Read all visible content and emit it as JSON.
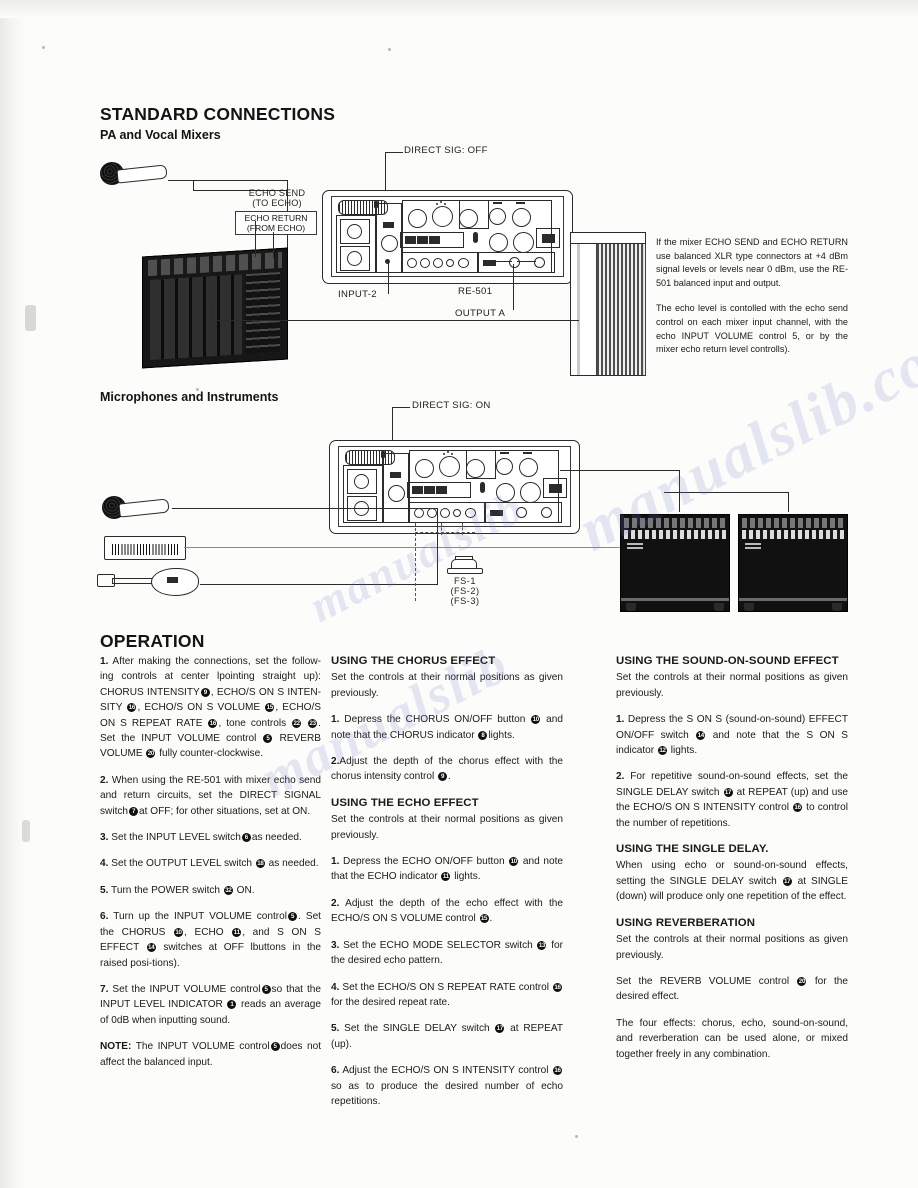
{
  "page": {
    "section_title": "STANDARD CONNECTIONS",
    "subsection_1": "PA and Vocal Mixers",
    "subsection_2": "Microphones and Instruments",
    "operation_title": "OPERATION"
  },
  "diagram1": {
    "name": "pa-and-vocal-mixers-diagram",
    "labels": {
      "direct_sig": "DIRECT SIG: OFF",
      "echo_send": "ECHO SEND",
      "echo_send_sub": "(TO ECHO)",
      "echo_return": "ECHO RETURN",
      "echo_return_sub": "(FROM ECHO)",
      "input2": "INPUT-2",
      "unit": "RE-501",
      "output_a": "OUTPUT A"
    },
    "note_paragraph_1": "If the mixer ECHO SEND and ECHO RETURN use balanced XLR type connectors at +4 dBm signal levels or levels near 0 dBm, use the RE-501 balanced input and output.",
    "note_paragraph_2": "The echo level is contolled with the echo send control on each mixer input channel, with the echo INPUT VOLUME control 5, or by the mixer echo return level controlls)."
  },
  "diagram2": {
    "name": "microphones-and-instruments-diagram",
    "labels": {
      "direct_sig": "DIRECT SIG: ON",
      "footswitch_1": "FS-1",
      "footswitch_2": "(FS-2)",
      "footswitch_3": "(FS-3)"
    }
  },
  "columns": {
    "left": [
      {
        "id": "step-1",
        "num": "1.",
        "runs": [
          {
            "t": " After making the connections, set the follow-ing controls at center lpointing straight up): CHORUS INTENSITY"
          },
          {
            "c": "9"
          },
          {
            "t": ", ECHO/S ON S INTEN-SITY "
          },
          {
            "c": "16"
          },
          {
            "t": ", ECHO/S ON S VOLUME "
          },
          {
            "c": "15"
          },
          {
            "t": ", ECHO/S ON S REPEAT RATE "
          },
          {
            "c": "16"
          },
          {
            "t": ", tone controls "
          },
          {
            "c": "22"
          },
          {
            "t": " "
          },
          {
            "c": "23"
          },
          {
            "t": ". Set the INPUT VOLUME control "
          },
          {
            "c": "5"
          },
          {
            "t": " REVERB VOLUME "
          },
          {
            "c": "20"
          },
          {
            "t": " fully counter-clockwise."
          }
        ]
      },
      {
        "id": "step-2",
        "num": "2.",
        "runs": [
          {
            "t": " When using the RE-501 with mixer echo send and return circuits, set the DIRECT SIGNAL switch"
          },
          {
            "c": "7"
          },
          {
            "t": "at OFF; for other situations, set at ON."
          }
        ]
      },
      {
        "id": "step-3",
        "num": "3.",
        "runs": [
          {
            "t": " Set the INPUT LEVEL switch"
          },
          {
            "c": "6"
          },
          {
            "t": "as needed."
          }
        ]
      },
      {
        "id": "step-4",
        "num": "4.",
        "runs": [
          {
            "t": " Set the OUTPUT LEVEL switch "
          },
          {
            "c": "18"
          },
          {
            "t": " as needed."
          }
        ]
      },
      {
        "id": "step-5",
        "num": "5.",
        "runs": [
          {
            "t": " Turn the POWER switch "
          },
          {
            "c": "32"
          },
          {
            "t": " ON."
          }
        ]
      },
      {
        "id": "step-6",
        "num": "6.",
        "runs": [
          {
            "t": " Turn up the INPUT VOLUME control"
          },
          {
            "c": "5"
          },
          {
            "t": ". Set the CHORUS "
          },
          {
            "c": "10"
          },
          {
            "t": ", ECHO "
          },
          {
            "c": "11"
          },
          {
            "t": ", and S ON S EFFECT "
          },
          {
            "c": "14"
          },
          {
            "t": " switches at OFF lbuttons in the raised posi-tions)."
          }
        ]
      },
      {
        "id": "step-7",
        "num": "7.",
        "runs": [
          {
            "t": " Set the INPUT VOLUME control"
          },
          {
            "c": "5"
          },
          {
            "t": "so that the INPUT LEVEL INDICATOR "
          },
          {
            "c": "1"
          },
          {
            "t": " reads an average of 0dB when inputting sound."
          }
        ]
      },
      {
        "id": "note",
        "num": "NOTE:",
        "runs": [
          {
            "t": " The INPUT VOLUME control"
          },
          {
            "c": "5"
          },
          {
            "t": "does not affect the balanced input."
          }
        ]
      }
    ],
    "middle": [
      {
        "id": "chorus-heading",
        "heading": "USING THE CHORUS EFFECT",
        "runs": [
          {
            "t": "Set the controls at their normal positions as given previously."
          }
        ]
      },
      {
        "id": "chorus-step-1",
        "num": "1.",
        "runs": [
          {
            "t": " Depress the CHORUS ON/OFF button "
          },
          {
            "c": "10"
          },
          {
            "t": " and note that the CHORUS indicator "
          },
          {
            "c": "8"
          },
          {
            "t": "lights."
          }
        ]
      },
      {
        "id": "chorus-step-2",
        "num": "2.",
        "runs": [
          {
            "t": "Adjust the depth of the chorus effect with the chorus intensity control "
          },
          {
            "c": "9"
          },
          {
            "t": "."
          }
        ]
      },
      {
        "id": "echo-heading",
        "heading": "USING THE ECHO EFFECT",
        "runs": [
          {
            "t": "Set the controls at their normal positions as given previously."
          }
        ]
      },
      {
        "id": "echo-step-1",
        "num": "1.",
        "runs": [
          {
            "t": " Depress the ECHO ON/OFF button "
          },
          {
            "c": "10"
          },
          {
            "t": " and note that the ECHO indicator "
          },
          {
            "c": "11"
          },
          {
            "t": " lights."
          }
        ]
      },
      {
        "id": "echo-step-2",
        "num": "2.",
        "runs": [
          {
            "t": " Adjust the depth of the echo effect with the ECHO/S ON S VOLUME control "
          },
          {
            "c": "15"
          },
          {
            "t": "."
          }
        ]
      },
      {
        "id": "echo-step-3",
        "num": "3.",
        "runs": [
          {
            "t": " Set the ECHO MODE SELECTOR switch "
          },
          {
            "c": "13"
          },
          {
            "t": " for the desired echo pattern."
          }
        ]
      },
      {
        "id": "echo-step-4",
        "num": "4.",
        "runs": [
          {
            "t": " Set the ECHO/S ON S REPEAT RATE control "
          },
          {
            "c": "16"
          },
          {
            "t": " for the desired repeat rate."
          }
        ]
      },
      {
        "id": "echo-step-5",
        "num": "5.",
        "runs": [
          {
            "t": " Set the SINGLE DELAY switch "
          },
          {
            "c": "17"
          },
          {
            "t": " at REPEAT (up)."
          }
        ]
      },
      {
        "id": "echo-step-6",
        "num": "6.",
        "runs": [
          {
            "t": " Adjust the ECHO/S ON S INTENSITY control "
          },
          {
            "c": "16"
          },
          {
            "t": " so as to produce the desired number of echo repetitions."
          }
        ]
      }
    ],
    "right": [
      {
        "id": "sos-heading",
        "heading": "USING THE SOUND-ON-SOUND EFFECT",
        "runs": [
          {
            "t": "Set the controls at their normal positions as given previously."
          }
        ]
      },
      {
        "id": "sos-step-1",
        "num": "1.",
        "runs": [
          {
            "t": " Depress the S ON S (sound-on-sound) EFFECT ON/OFF switch "
          },
          {
            "c": "14"
          },
          {
            "t": " and note that the S ON S indicator "
          },
          {
            "c": "12"
          },
          {
            "t": " lights."
          }
        ]
      },
      {
        "id": "sos-step-2",
        "num": "2.",
        "runs": [
          {
            "t": " For repetitive sound-on-sound effects, set the SINGLE DELAY switch "
          },
          {
            "c": "17"
          },
          {
            "t": " at REPEAT (up) and use the ECHO/S ON S INTENSITY control "
          },
          {
            "c": "16"
          },
          {
            "t": " to control the number of repetitions."
          }
        ]
      },
      {
        "id": "single-delay-heading",
        "heading": "USING THE SINGLE DELAY.",
        "runs": [
          {
            "t": "When using echo or sound-on-sound effects, setting the SINGLE DELAY switch "
          },
          {
            "c": "17"
          },
          {
            "t": " at SINGLE (down) will produce only one repetition of the effect."
          }
        ]
      },
      {
        "id": "reverb-heading",
        "heading": "USING REVERBERATION",
        "runs": [
          {
            "t": "Set the controls at their normal positions as given previously."
          }
        ]
      },
      {
        "id": "reverb-body",
        "runs": [
          {
            "t": "Set the REVERB VOLUME control "
          },
          {
            "c": "20"
          },
          {
            "t": " for the desired effect."
          }
        ]
      },
      {
        "id": "summary",
        "runs": [
          {
            "t": "The four effects: chorus, echo, sound-on-sound, and reverberation can be used alone, or mixed together freely in any combination."
          }
        ]
      }
    ]
  },
  "watermarks": [
    "manualslib",
    "manualslib.com",
    "manualslib"
  ]
}
